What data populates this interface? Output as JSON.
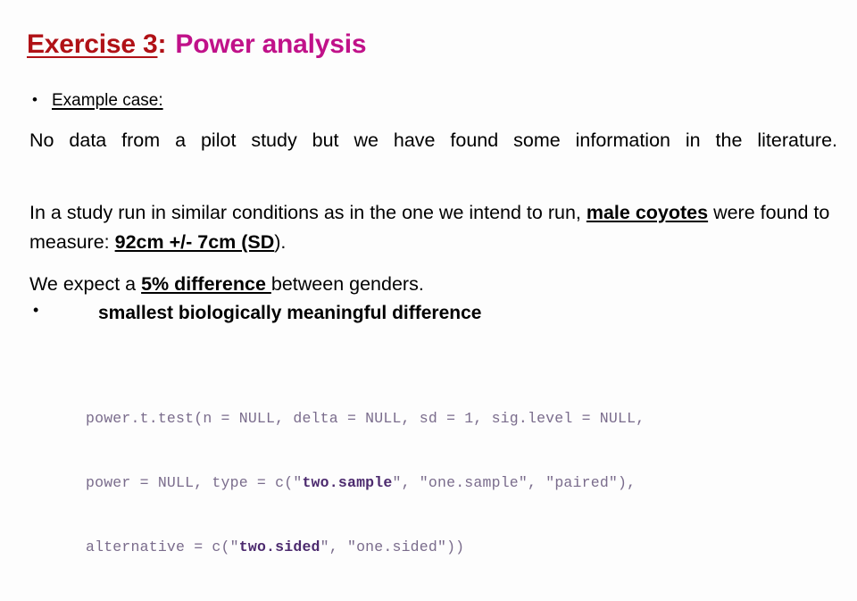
{
  "slide": {
    "title": {
      "part_a": "Exercise 3",
      "colon": ":",
      "part_b": "Power analysis"
    },
    "bullet_glyph": "•",
    "example_case": {
      "label": "Example case:"
    },
    "paragraph_1": {
      "text": "No data from a pilot study but we have found some information in the literature."
    },
    "paragraph_2": {
      "lead": "In a study run in similar conditions as in the one we intend to run, ",
      "emphasis_1": "male coyotes",
      "middle": " were found to measure: ",
      "emphasis_2": "92cm +/- 7cm (SD",
      "tail": ")."
    },
    "paragraph_3": {
      "lead": "We expect a ",
      "emphasis": "5% difference ",
      "tail": "between genders."
    },
    "sub_bullet": {
      "text": "smallest biologically meaningful difference"
    },
    "code": {
      "line1_a": "power.t.test(n = NULL, delta = NULL, sd = 1, sig.level = NULL,",
      "line2_a": "power = NULL, type = c(\"",
      "line2_b": "two.sample",
      "line2_c": "\", \"one.sample\", \"paired\"),",
      "line3_a": "alternative = c(\"",
      "line3_b": "two.sided",
      "line3_c": "\", \"one.sided\"))"
    },
    "colors": {
      "title_red": "#B01116",
      "title_magenta": "#C01189",
      "code_normal": "#7A6C8C",
      "code_bold": "#4C2A6E",
      "background": "#FDFDFD",
      "text": "#000000"
    }
  }
}
